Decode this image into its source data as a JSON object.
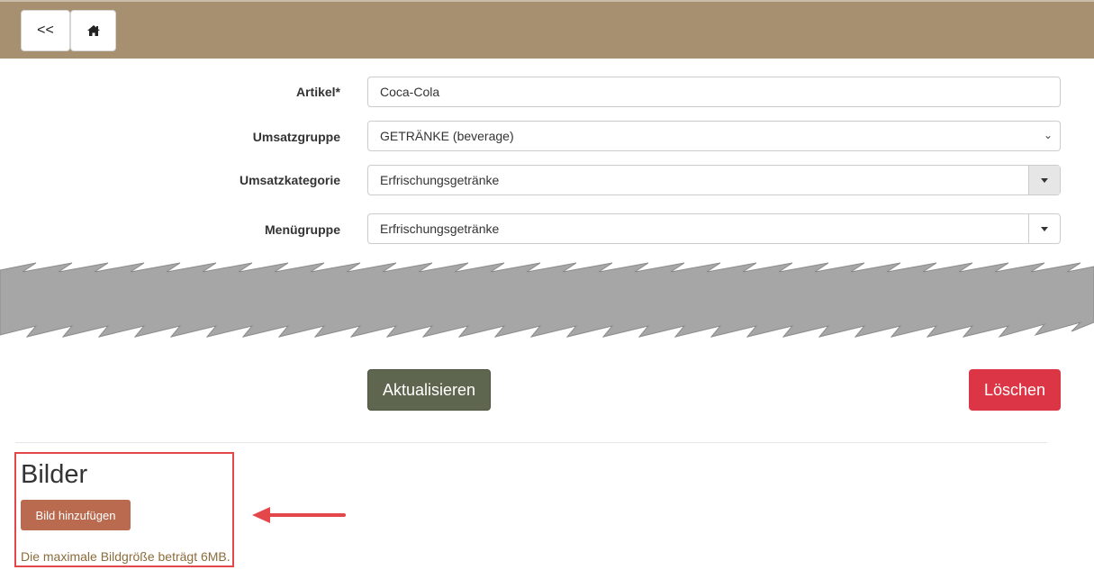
{
  "nav": {
    "back_label": "<<",
    "home_icon": "home-icon"
  },
  "form": {
    "article": {
      "label": "Artikel*",
      "value": "Coca-Cola"
    },
    "sales_group": {
      "label": "Umsatzgruppe",
      "value": "GETRÄNKE (beverage)"
    },
    "sales_category": {
      "label": "Umsatzkategorie",
      "value": "Erfrischungsgetränke"
    },
    "menu_group": {
      "label": "Menügruppe",
      "value": "Erfrischungsgetränke"
    }
  },
  "actions": {
    "update_label": "Aktualisieren",
    "delete_label": "Löschen"
  },
  "images": {
    "title": "Bilder",
    "add_label": "Bild hinzufügen",
    "note": "Die maximale Bildgröße beträgt 6MB."
  },
  "colors": {
    "header": "#a79070",
    "update_button": "#5f6650",
    "delete_button": "#dc3545",
    "add_button": "#b96a4f",
    "highlight": "#e4474a"
  }
}
